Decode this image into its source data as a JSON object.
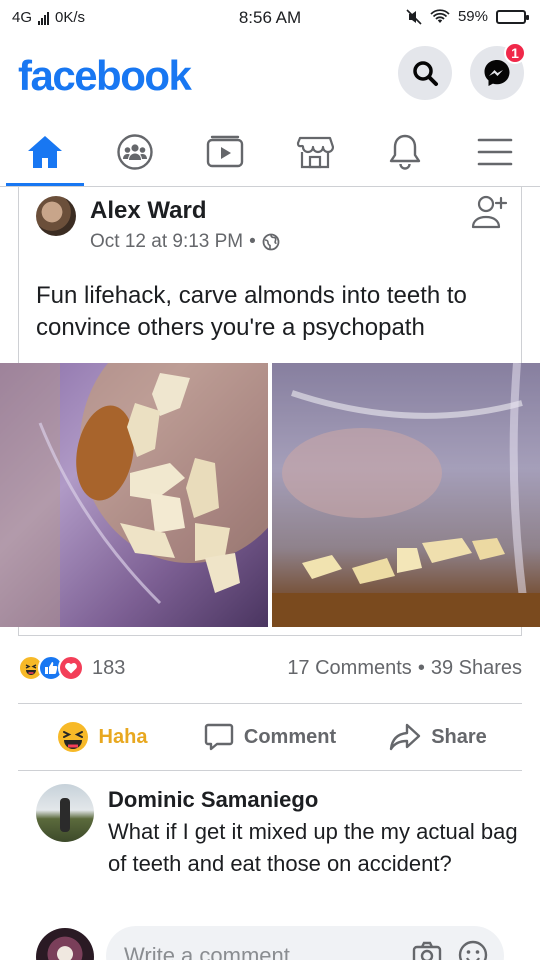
{
  "status_bar": {
    "network": "4G",
    "speed": "0K/s",
    "time": "8:56 AM",
    "battery": "59%",
    "battery_level": 0.59
  },
  "header": {
    "logo": "facebook",
    "messenger_badge": "1",
    "icons": [
      "search-icon",
      "messenger-icon"
    ]
  },
  "nav": {
    "tabs": [
      "home-icon",
      "groups-icon",
      "watch-icon",
      "marketplace-icon",
      "notifications-icon",
      "menu-icon"
    ],
    "active": "home"
  },
  "post": {
    "author": "Alex Ward",
    "timestamp": "Oct 12 at 9:13 PM",
    "separator": "•",
    "text": "Fun lifehack, carve almonds into teeth to convince others you're a psychopath",
    "reaction_count": "183",
    "comments": "17 Comments",
    "shares": "39 Shares",
    "counts_sep": "•"
  },
  "actions": {
    "haha": "Haha",
    "comment": "Comment",
    "share": "Share"
  },
  "comment": {
    "name": "Dominic Samaniego",
    "text": "What if I get it mixed up the my actual bag of teeth and eat those on accident?"
  },
  "composer": {
    "placeholder": "Write a comment..."
  },
  "colors": {
    "brand": "#1877f2",
    "haha": "#f7b928",
    "love": "#f33e58",
    "badge": "#f02849"
  }
}
